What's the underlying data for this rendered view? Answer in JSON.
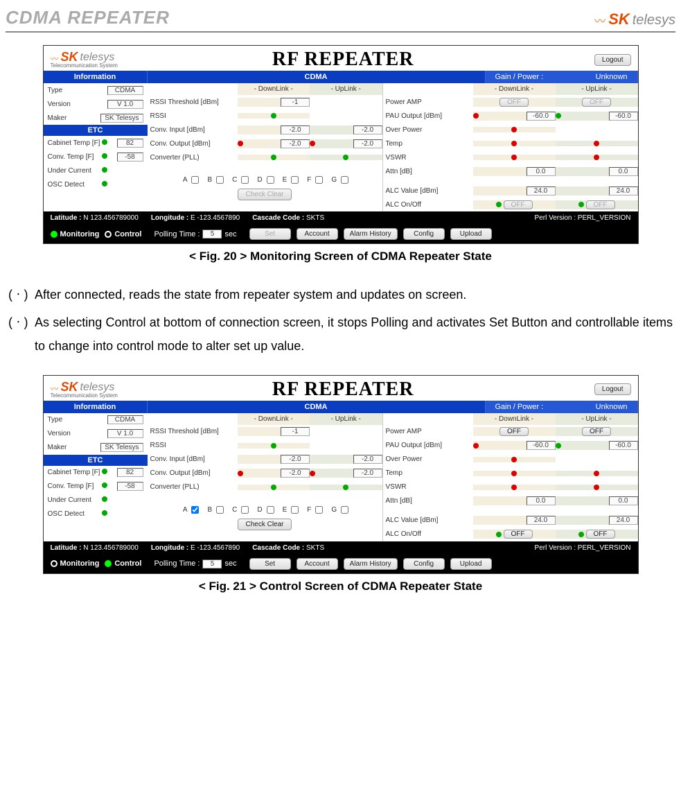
{
  "doc": {
    "header_title": "CDMA REPEATER",
    "logo_sk": "SK",
    "logo_telesys": "telesys"
  },
  "fig20_caption": "< Fig. 20 > Monitoring Screen of CDMA Repeater State",
  "fig21_caption": "< Fig. 21 > Control Screen of CDMA Repeater State",
  "paragraphs": {
    "p1_marker": "(ㆍ)",
    "p1_text": "After connected, reads the state from repeater system and updates on screen.",
    "p2_marker": "(ㆍ)",
    "p2_text": "As selecting Control at bottom of connection screen, it stops Polling and activates Set Button and controllable items to change into control mode to alter set up value."
  },
  "ui": {
    "app_title": "RF  REPEATER",
    "logout": "Logout",
    "tab_info": "Information",
    "tab_cdma": "CDMA",
    "gain_power_label": "Gain / Power :",
    "gain_power_value": "Unknown",
    "downlink": "- DownLink -",
    "uplink": "- UpLink -",
    "info": {
      "type_label": "Type",
      "type_value": "CDMA",
      "version_label": "Version",
      "version_value": "V 1.0",
      "maker_label": "Maker",
      "maker_value": "SK Telesys"
    },
    "etc_header": "ETC",
    "etc": {
      "cabinet_label": "Cabinet Temp [F]",
      "cabinet_value": "82",
      "conv_label": "Conv. Temp [F]",
      "conv_value": "-58",
      "under_current_label": "Under Current",
      "osc_label": "OSC Detect"
    },
    "mid": {
      "rssi_thresh_label": "RSSI Threshold [dBm]",
      "rssi_thresh_dl": "-1",
      "rssi_label": "RSSI",
      "conv_in_label": "Conv. Input [dBm]",
      "conv_in_dl": "-2.0",
      "conv_in_ul": "-2.0",
      "conv_out_label": "Conv. Output [dBm]",
      "conv_out_dl": "-2.0",
      "conv_out_ul": "-2.0",
      "conv_pll_label": "Converter (PLL)"
    },
    "letters": {
      "A": "A",
      "B": "B",
      "C": "C",
      "D": "D",
      "E": "E",
      "F": "F",
      "G": "G"
    },
    "check_clear": "Check Clear",
    "right": {
      "power_amp_label": "Power AMP",
      "power_amp_dl": "OFF",
      "power_amp_ul": "OFF",
      "pau_label": "PAU Output [dBm]",
      "pau_dl": "-60.0",
      "pau_ul": "-60.0",
      "over_power_label": "Over Power",
      "temp_label": "Temp",
      "vswr_label": "VSWR",
      "attn_label": "Attn [dB]",
      "attn_dl": "0.0",
      "attn_ul": "0.0",
      "alc_val_label": "ALC Value [dBm]",
      "alc_val_dl": "24.0",
      "alc_val_ul": "24.0",
      "alc_onoff_label": "ALC On/Off",
      "alc_onoff_dl": "OFF",
      "alc_onoff_ul": "OFF"
    },
    "status": {
      "lat_label": "Latitude :",
      "lat_value": "N 123.456789000",
      "lon_label": "Longitude :",
      "lon_value": "E  -123.4567890",
      "cascade_label": "Cascade Code :",
      "cascade_value": "SKTS",
      "perl_label": "Perl Version :",
      "perl_value": "PERL_VERSION"
    },
    "ctrl": {
      "monitoring": "Monitoring",
      "control": "Control",
      "polling_label": "Polling Time :",
      "polling_value": "5",
      "polling_unit": "sec",
      "set": "Set",
      "account": "Account",
      "alarm": "Alarm History",
      "config": "Config",
      "upload": "Upload"
    }
  }
}
